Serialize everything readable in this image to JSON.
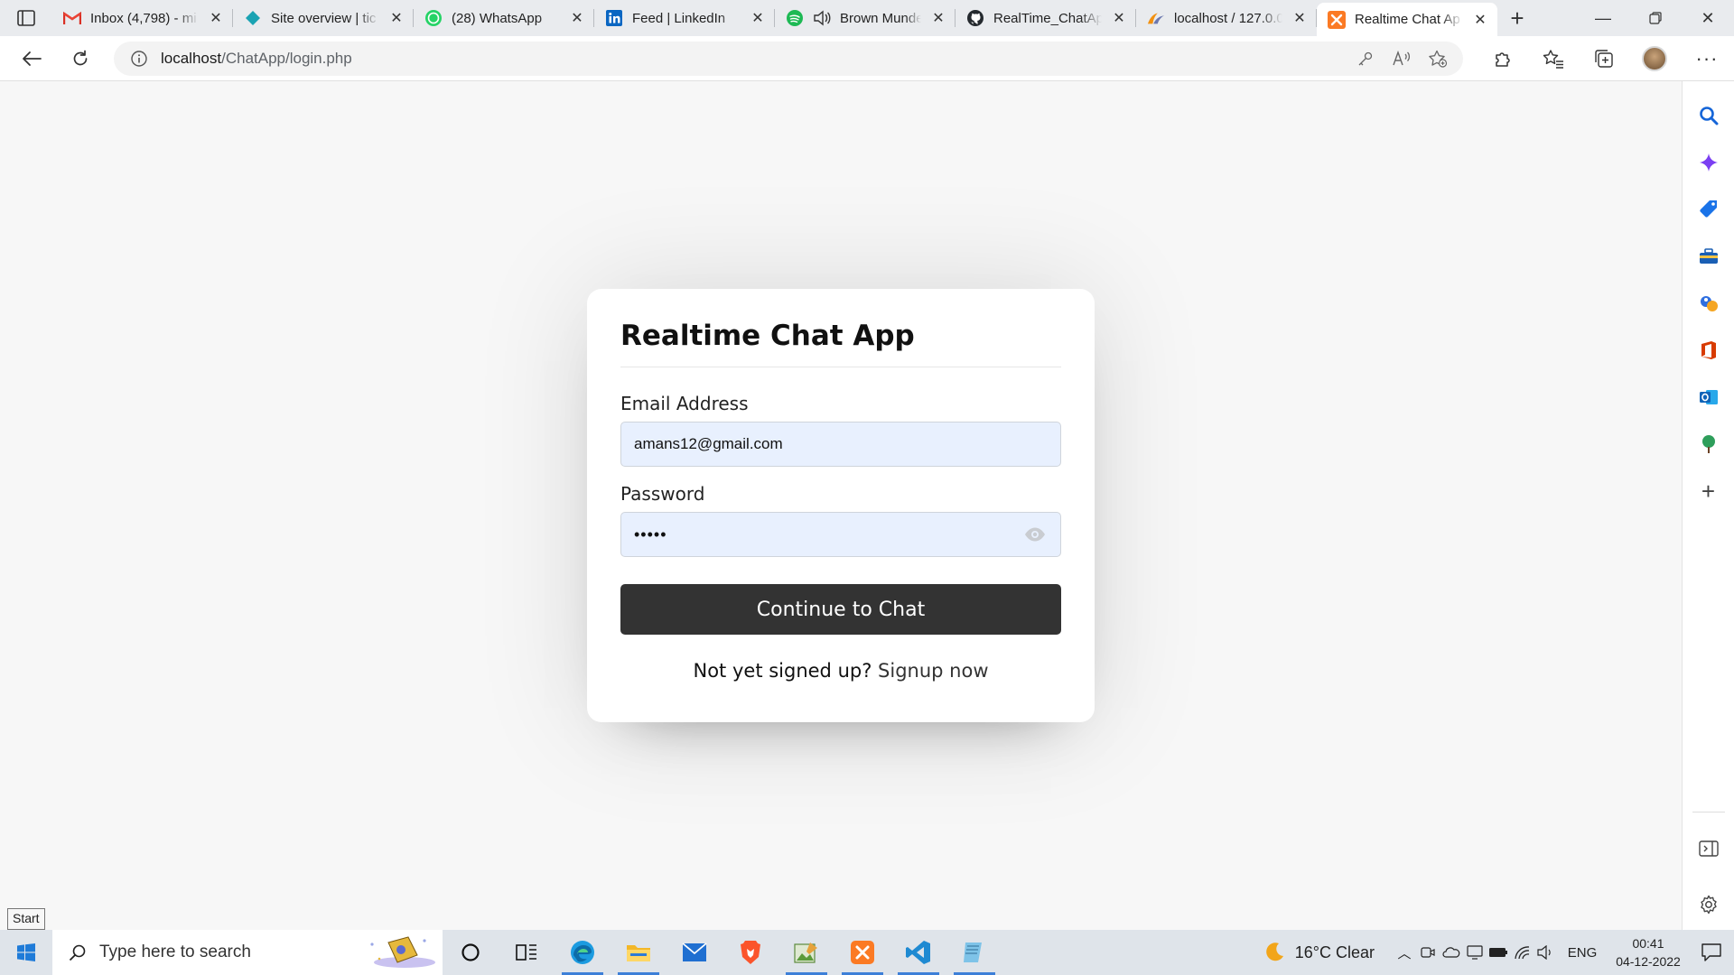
{
  "browser": {
    "tabs": [
      {
        "title": "Inbox (4,798) - mi",
        "icon": "gmail-icon"
      },
      {
        "title": "Site overview | tic",
        "icon": "diamond-icon"
      },
      {
        "title": "(28) WhatsApp",
        "icon": "whatsapp-icon"
      },
      {
        "title": "Feed | LinkedIn",
        "icon": "linkedin-icon"
      },
      {
        "title": "Brown Munde",
        "icon": "spotify-icon"
      },
      {
        "title": "RealTime_ChatAp",
        "icon": "github-icon"
      },
      {
        "title": "localhost / 127.0.0",
        "icon": "phpmyadmin-icon"
      },
      {
        "title": "Realtime Chat Ap",
        "icon": "xampp-icon"
      }
    ],
    "url_host": "localhost",
    "url_path": "/ChatApp/login.php"
  },
  "login": {
    "title": "Realtime Chat App",
    "email_label": "Email Address",
    "email_value": "amans12@gmail.com",
    "password_label": "Password",
    "password_value": "•••••",
    "submit_label": "Continue to Chat",
    "signup_prompt": "Not yet signed up?",
    "signup_link": "Signup now"
  },
  "tooltip": {
    "start": "Start"
  },
  "taskbar": {
    "search_placeholder": "Type here to search",
    "weather": "16°C  Clear",
    "language": "ENG",
    "time": "00:41",
    "date": "04-12-2022"
  },
  "colors": {
    "button_bg": "#333333",
    "input_bg": "#e8f0fe",
    "page_bg": "#f7f7f7",
    "accent": "#3d7fd8"
  }
}
